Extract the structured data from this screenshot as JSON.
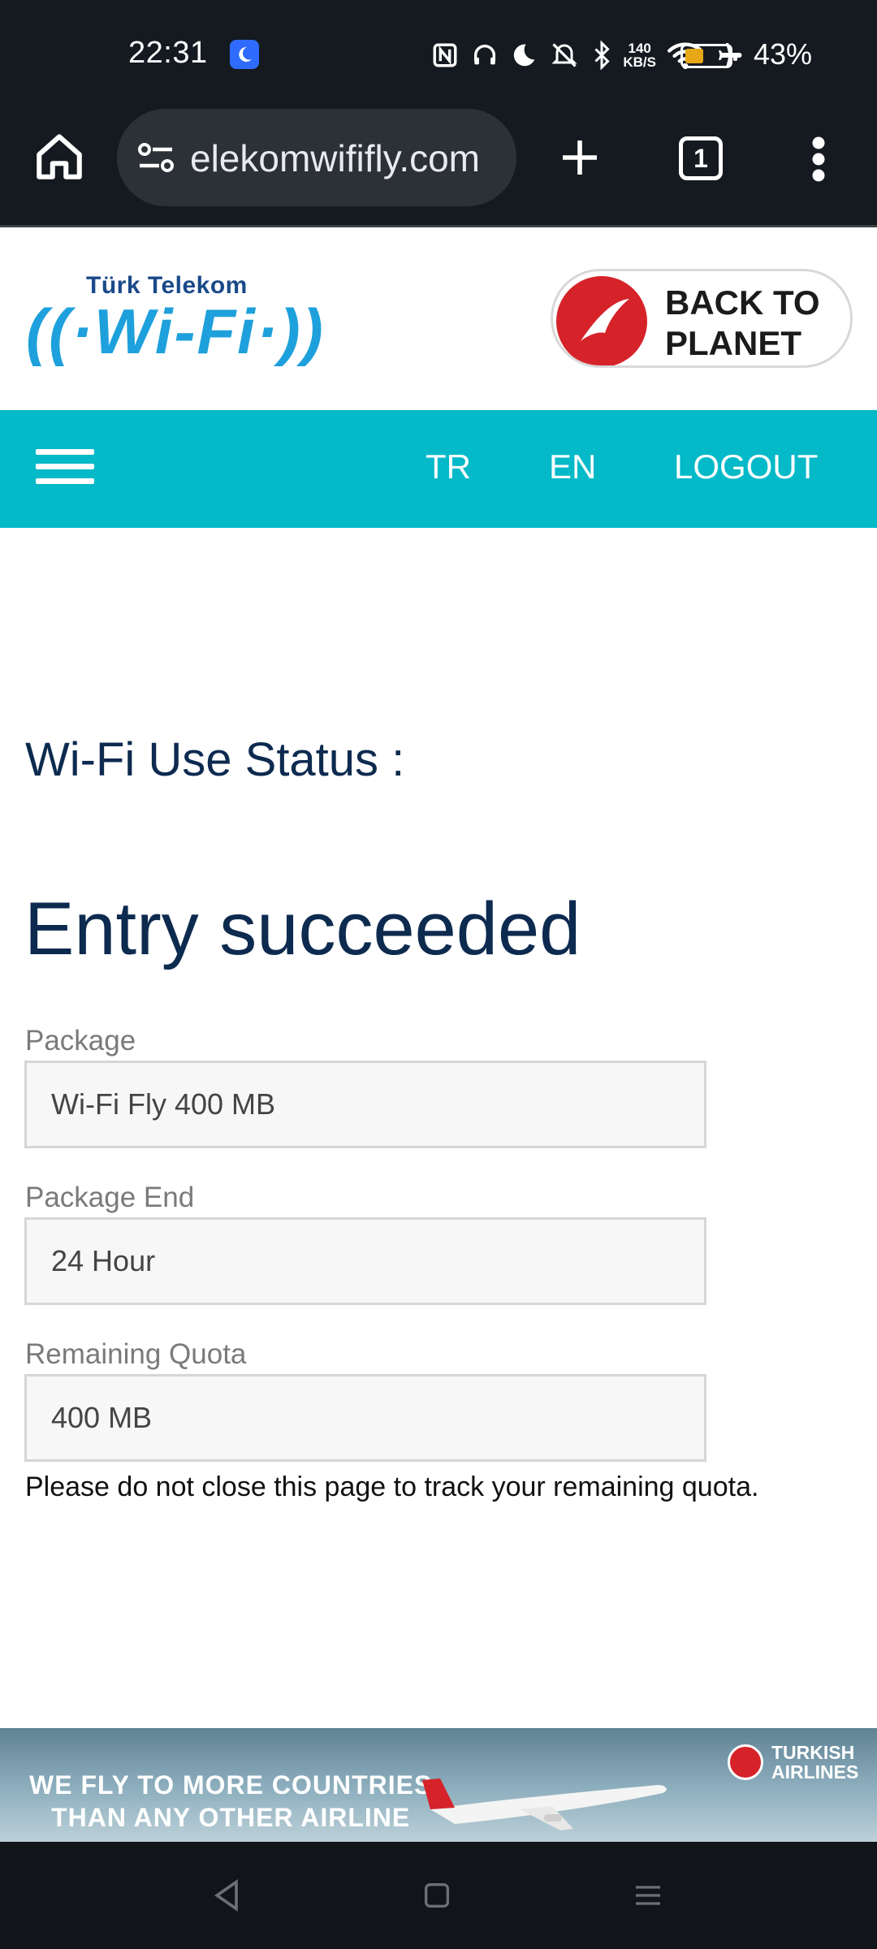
{
  "status_bar": {
    "time": "22:31",
    "network_speed_value": "140",
    "network_speed_unit": "KB/S",
    "battery_percent": "43%",
    "battery_level": 0.43,
    "icons": [
      "moon-badge-icon",
      "nfc-icon",
      "headphones-icon",
      "moon-icon",
      "mute-icon",
      "bluetooth-icon",
      "wifi-icon",
      "airplane-icon",
      "battery-icon"
    ]
  },
  "browser": {
    "url": "elekomwififly.com",
    "tab_count": "1",
    "icons": [
      "home-icon",
      "site-settings-icon",
      "plus-icon",
      "tabs-icon",
      "more-vert-icon"
    ]
  },
  "header": {
    "logo_top": "Türk Telekom",
    "logo_main": "((·Wi-Fi·))",
    "back_to_planet": "BACK TO PLANET",
    "brand_colors": {
      "telekom_blue": "#1ea0dc",
      "thy_red": "#d6232a"
    }
  },
  "nav": {
    "bg_color": "#04b9c8",
    "links": [
      "TR",
      "EN",
      "LOGOUT"
    ]
  },
  "content": {
    "status_title": "Wi-Fi Use Status :",
    "entry_title": "Entry succeeded",
    "fields": [
      {
        "label": "Package",
        "value": "Wi-Fi Fly 400 MB"
      },
      {
        "label": "Package End",
        "value": "24 Hour"
      },
      {
        "label": "Remaining Quota",
        "value": "400 MB"
      }
    ],
    "note": "Please do not close this page to track your remaining quota."
  },
  "ad": {
    "line1": "WE FLY TO MORE COUNTRIES",
    "line2": "THAN ANY OTHER AIRLINE",
    "brand_line1": "TURKISH",
    "brand_line2": "AIRLINES"
  },
  "system_nav": {
    "icons": [
      "back-icon",
      "home-square-icon",
      "recents-icon"
    ]
  }
}
